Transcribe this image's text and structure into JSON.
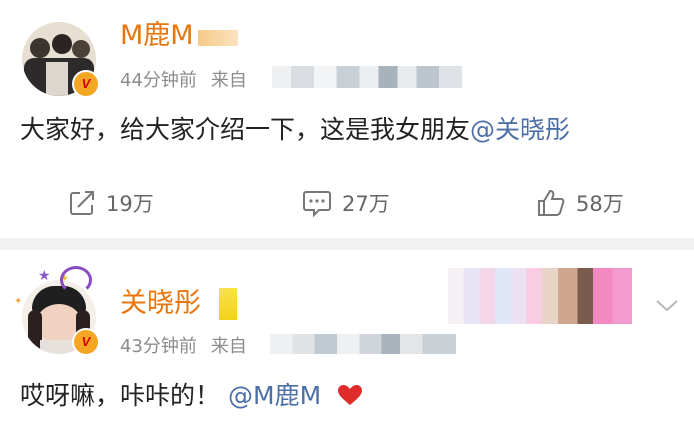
{
  "post1": {
    "author": "M鹿M",
    "time": "44分钟前",
    "source_prefix": "来自",
    "content_text": "大家好，给大家介绍一下，这是我女朋友",
    "mention": "@关晓彤",
    "actions": {
      "repost_count": "19万",
      "comment_count": "27万",
      "like_count": "58万"
    },
    "icons": {
      "repost": "share-icon",
      "comment": "comment-icon",
      "like": "thumbs-up-icon",
      "verified": "verified-badge-icon"
    }
  },
  "post2": {
    "author": "关晓彤",
    "time": "43分钟前",
    "source_prefix": "来自",
    "content_text": "哎呀嘛，咔咔的！",
    "mention": "@M鹿M",
    "icons": {
      "heart": "heart-icon",
      "chevron": "chevron-down-icon",
      "verified": "verified-badge-icon"
    }
  },
  "colors": {
    "name": "#e8760f",
    "mention": "#4d6fa8",
    "meta": "#8c8c8c",
    "text": "#222222",
    "heart": "#e02b2b",
    "badge": "#f5a623"
  }
}
